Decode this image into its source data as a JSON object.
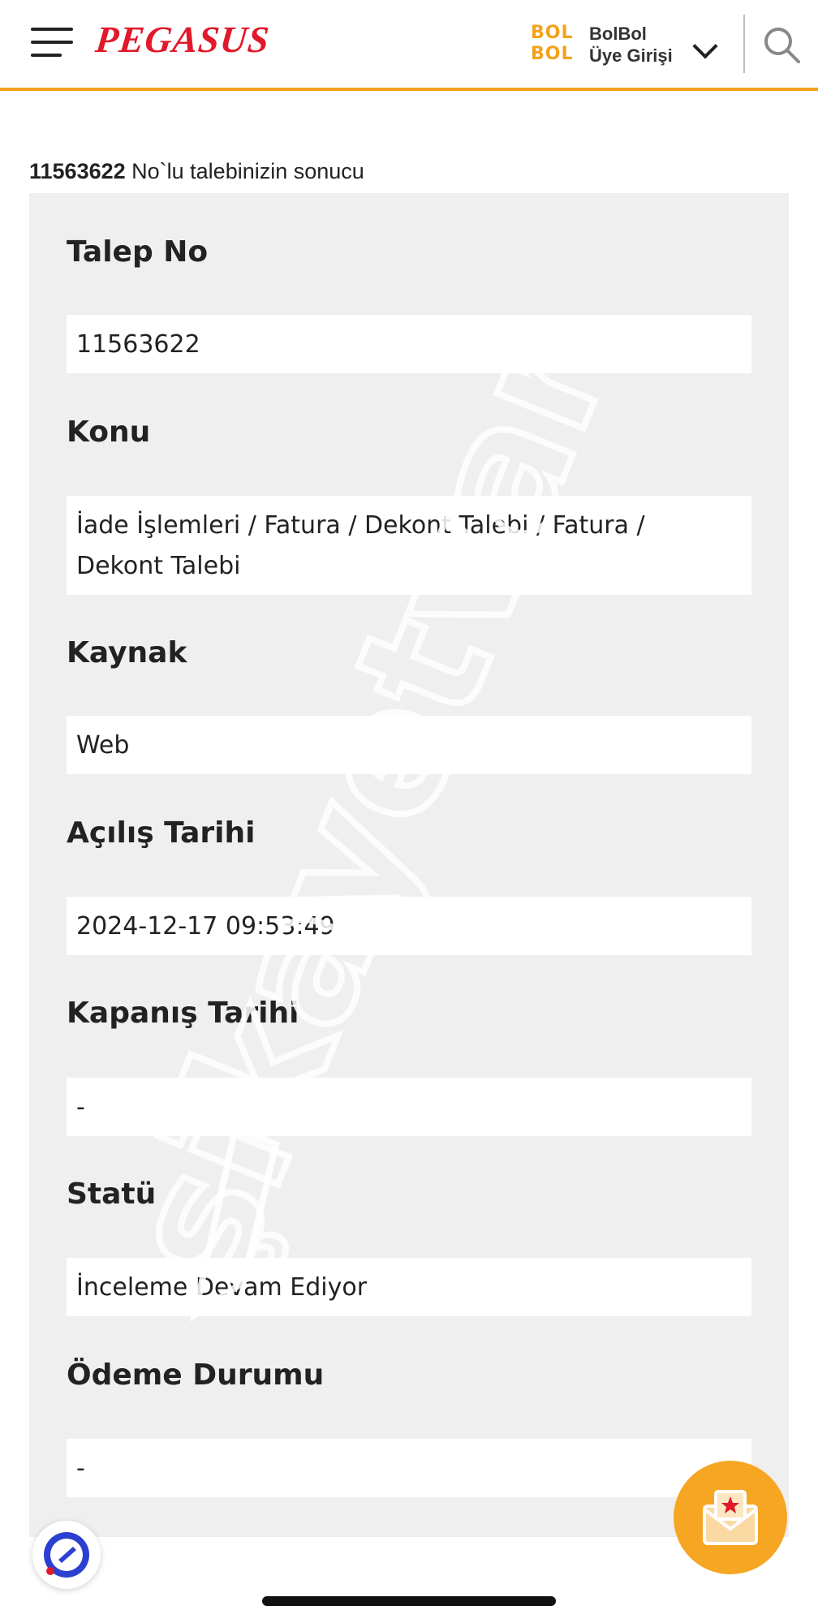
{
  "header": {
    "logo_text": "PEGASUS",
    "bolbol_mark_top": "BOL",
    "bolbol_mark_bottom": "BOL",
    "account_line1": "BolBol",
    "account_line2": "Üye Girişi"
  },
  "intro": {
    "request_number": "11563622",
    "suffix": " No`lu talebinizin sonucu"
  },
  "fields": [
    {
      "label": "Talep No",
      "value": "11563622"
    },
    {
      "label": "Konu",
      "value_line1": "İade İşlemleri / Fatura / Dekont Talebi / Fatura /",
      "value_line2": "Dekont Talebi"
    },
    {
      "label": "Kaynak",
      "value": "Web"
    },
    {
      "label": "Açılış Tarihi",
      "value": "2024-12-17 09:53:49"
    },
    {
      "label": "Kapanış Tarihi",
      "value": "-"
    },
    {
      "label": "Statü",
      "value": "İnceleme Devam Ediyor"
    },
    {
      "label": "Ödeme Durumu",
      "value": "-"
    }
  ],
  "watermark": "şikayetvar",
  "colors": {
    "brand_red": "#e1192a",
    "accent_orange": "#f4a21b",
    "card_bg": "#efefef"
  },
  "icons": [
    "menu-icon",
    "chevron-down-icon",
    "search-icon",
    "mail-star-icon",
    "chat-help-icon"
  ]
}
